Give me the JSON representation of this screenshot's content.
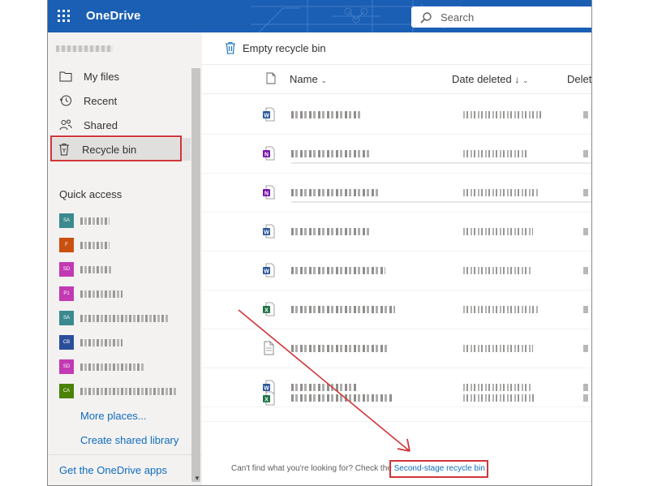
{
  "app": {
    "brand": "OneDrive",
    "search_placeholder": "Search"
  },
  "sidebar": {
    "nav_items": [
      {
        "label": "My files",
        "icon": "folder-icon"
      },
      {
        "label": "Recent",
        "icon": "history-icon"
      },
      {
        "label": "Shared",
        "icon": "people-icon"
      },
      {
        "label": "Recycle bin",
        "icon": "recycle-bin-icon",
        "selected": true
      }
    ],
    "quick_access_title": "Quick access",
    "quick_access_items": [
      {
        "initials": "SA",
        "color": "#3a8a8f"
      },
      {
        "initials": "F",
        "color": "#ca5010"
      },
      {
        "initials": "SD",
        "color": "#c239b3"
      },
      {
        "initials": "P1",
        "color": "#c239b3"
      },
      {
        "initials": "SA",
        "color": "#3a8a8f"
      },
      {
        "initials": "CB",
        "color": "#2b4e9a"
      },
      {
        "initials": "SD",
        "color": "#c239b3"
      },
      {
        "initials": "CA",
        "color": "#498205"
      }
    ],
    "more_places": "More places...",
    "create_shared_library": "Create shared library",
    "get_apps": "Get the OneDrive apps"
  },
  "commandbar": {
    "empty_recycle_bin": "Empty recycle bin"
  },
  "table": {
    "columns": {
      "name": "Name",
      "date_deleted": "Date deleted",
      "deleted_by": "Delet"
    },
    "rows": [
      {
        "type": "word"
      },
      {
        "type": "onenote"
      },
      {
        "type": "onenote"
      },
      {
        "type": "word"
      },
      {
        "type": "word"
      },
      {
        "type": "excel"
      },
      {
        "type": "generic"
      },
      {
        "type": "word"
      },
      {
        "type": "excel"
      }
    ]
  },
  "footer": {
    "message": "Can't find what you're looking for? Check the",
    "second_stage_link": "Second-stage recycle bin"
  },
  "colors": {
    "topbar": "#1a5fb4",
    "accent": "#0f6cbd",
    "annotation": "#d13438"
  }
}
